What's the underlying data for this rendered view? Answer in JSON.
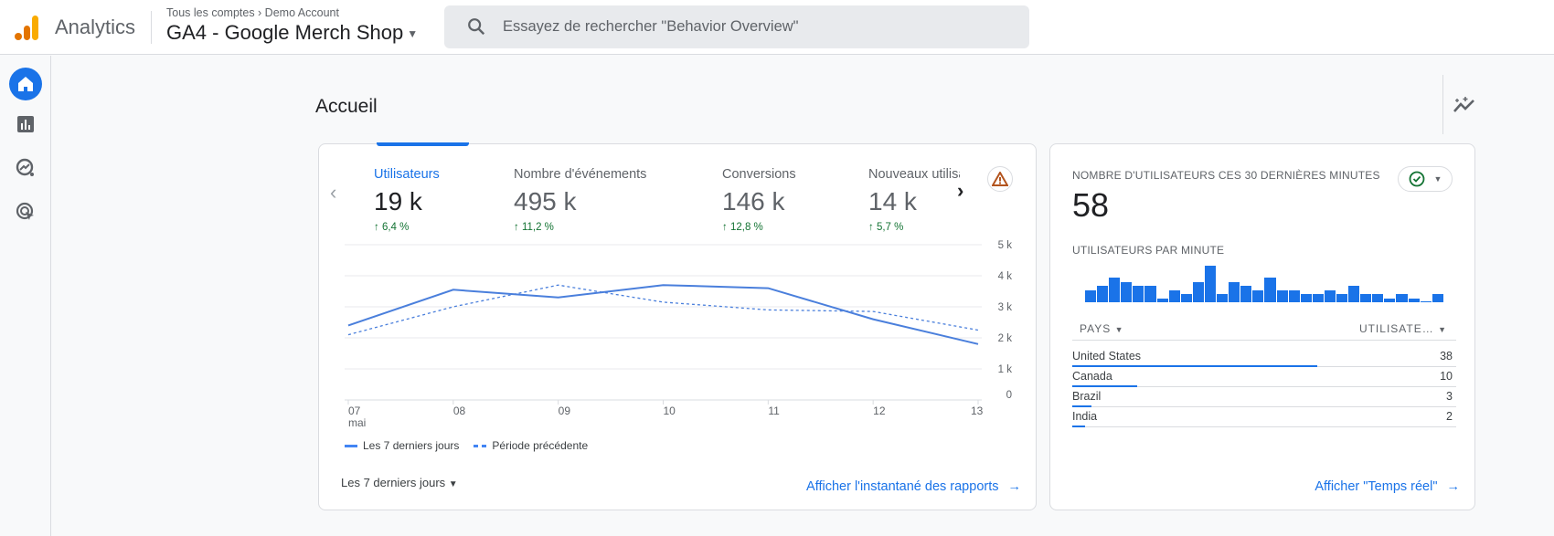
{
  "app": {
    "brand": "Analytics",
    "breadcrumb": "Tous les comptes › Demo Account",
    "property": "GA4 - Google Merch Shop"
  },
  "search": {
    "placeholder": "Essayez de rechercher \"Behavior Overview\""
  },
  "sidebar": {
    "items": [
      {
        "name": "home",
        "icon": "home-icon",
        "active": true
      },
      {
        "name": "reports",
        "icon": "bar-chart-icon"
      },
      {
        "name": "explore",
        "icon": "explore-icon"
      },
      {
        "name": "advertising",
        "icon": "target-cursor-icon"
      }
    ]
  },
  "page": {
    "title": "Accueil"
  },
  "overview": {
    "metrics": [
      {
        "label": "Utilisateurs",
        "value": "19 k",
        "delta": "6,4 %",
        "active": true
      },
      {
        "label": "Nombre d'événements",
        "value": "495 k",
        "delta": "11,2 %"
      },
      {
        "label": "Conversions",
        "value": "146 k",
        "delta": "12,8 %"
      },
      {
        "label": "Nouveaux utilisateurs",
        "value": "14 k",
        "delta": "5,7 %"
      }
    ],
    "legend": {
      "current": "Les 7 derniers jours",
      "previous": "Période précédente"
    },
    "range": "Les 7 derniers jours",
    "link": "Afficher l'instantané des rapports"
  },
  "chart_data": {
    "type": "line",
    "x": [
      "07",
      "08",
      "09",
      "10",
      "11",
      "12",
      "13"
    ],
    "x_sublabel": "mai",
    "series": [
      {
        "name": "Les 7 derniers jours",
        "style": "solid",
        "values": [
          2400,
          3550,
          3300,
          3700,
          3600,
          2600,
          1800
        ]
      },
      {
        "name": "Période précédente",
        "style": "dashed",
        "values": [
          2100,
          3000,
          3700,
          3150,
          2900,
          2850,
          2250
        ]
      }
    ],
    "yticks": [
      "0",
      "1 k",
      "2 k",
      "3 k",
      "4 k",
      "5 k"
    ],
    "ylim": [
      0,
      5000
    ],
    "grid": true,
    "legend": "bottom-left"
  },
  "realtime": {
    "title": "NOMBRE D'UTILISATEURS CES 30 DERNIÈRES MINUTES",
    "value": "58",
    "subtitle": "UTILISATEURS PAR MINUTE",
    "per_minute": [
      3,
      4,
      6,
      5,
      4,
      4,
      1,
      3,
      2,
      5,
      9,
      2,
      5,
      4,
      3,
      6,
      3,
      3,
      2,
      2,
      3,
      2,
      4,
      2,
      2,
      1,
      2,
      1,
      0.2,
      2
    ],
    "table": {
      "col1": "PAYS",
      "col2": "UTILISATE…",
      "rows": [
        {
          "country": "United States",
          "users": "38",
          "share": 38
        },
        {
          "country": "Canada",
          "users": "10",
          "share": 10
        },
        {
          "country": "Brazil",
          "users": "3",
          "share": 3
        },
        {
          "country": "India",
          "users": "2",
          "share": 2
        }
      ]
    },
    "link": "Afficher \"Temps réel\""
  }
}
